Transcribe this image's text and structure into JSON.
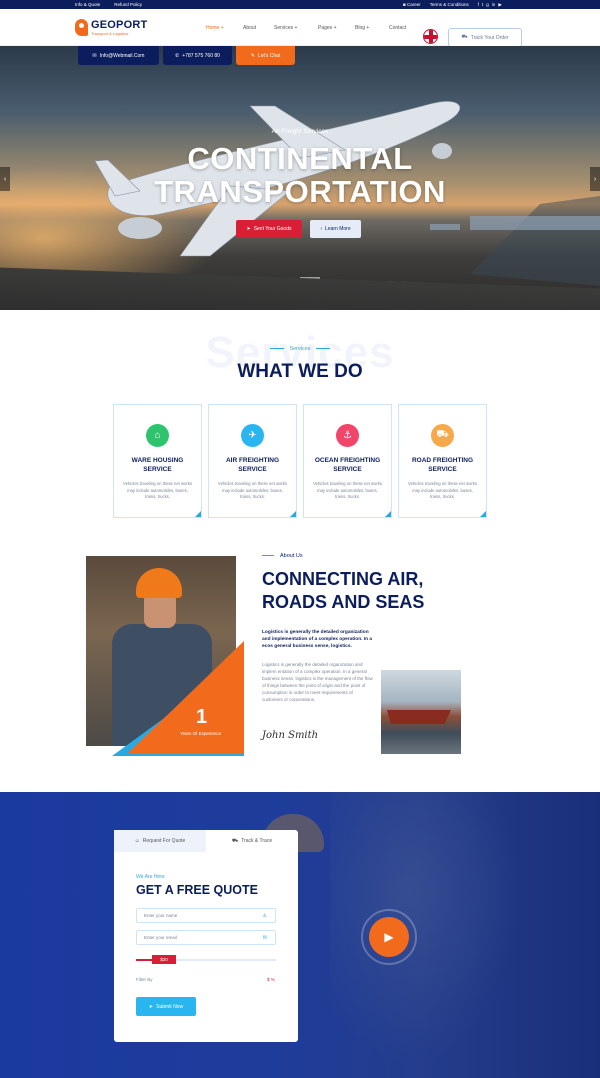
{
  "topbar": {
    "links": [
      "Info & Quote",
      "Refund Policy"
    ],
    "career": "Career",
    "terms": "Terms & Conditions",
    "social_icons": [
      "facebook-icon",
      "twitter-icon",
      "google-icon",
      "linkedin-icon",
      "youtube-icon"
    ]
  },
  "brand": {
    "name": "GEOPORT",
    "tagline": "Transport & Logistics"
  },
  "nav": {
    "items": [
      "Home +",
      "About",
      "Services +",
      "Pages +",
      "Blog +",
      "Contact"
    ],
    "active_index": 0
  },
  "header": {
    "track_order": "Track Your Order"
  },
  "contact_pills": {
    "email": "Info@Webmail.Com",
    "phone": "+787 575 760 80",
    "chat": "Let's Chat"
  },
  "hero": {
    "subtitle": "Air Freight Services",
    "title_line1": "CONTINENTAL",
    "title_line2": "TRANSPORTATION",
    "primary_button": "Sent Your Goods",
    "secondary_button": "Learn More"
  },
  "services": {
    "background_word": "Services",
    "kicker": "Services",
    "title": "WHAT WE DO",
    "cards": [
      {
        "title_line1": "WARE HOUSING",
        "title_line2": "SERVICE",
        "icon": "home-icon",
        "color": "#2ec46d",
        "description": "Vehicles traveling on these net works may include automobiles, buses, trains, trucks."
      },
      {
        "title_line1": "AIR FREIGHTING",
        "title_line2": "SERVICE",
        "icon": "plane-icon",
        "color": "#29b6f0",
        "description": "Vehicles traveling on these net works may include automobiles, buses, trains, trucks."
      },
      {
        "title_line1": "OCEAN FREIGHTING",
        "title_line2": "SERVICE",
        "icon": "ship-icon",
        "color": "#f2456a",
        "description": "Vehicles traveling on these net works may include automobiles, buses, trains, trucks."
      },
      {
        "title_line1": "ROAD FREIGHTING",
        "title_line2": "SERVICE",
        "icon": "truck-icon",
        "color": "#f7a94a",
        "description": "Vehicles traveling on these net works may include automobiles, buses, trains, trucks."
      }
    ]
  },
  "about": {
    "kicker": "About Us",
    "title_line1": "CONNECTING AIR,",
    "title_line2": "ROADS AND SEAS",
    "lead": "Logistics is generally the detailed organization and implementation of a complex operation. In a ecos general business sense, logistics.",
    "body": "Logistics is generally the detailed organization and implem entation of a complex operation. In a general business sense, logistics is the management of the flow of things between the point of origin and the point of consumption in order to meet requirements of customers or corporations.",
    "years_number": "1",
    "years_label": "Years Of Experience",
    "signature": "John Smith"
  },
  "quote": {
    "tabs": [
      "Request For Quote",
      "Track & Trace"
    ],
    "active_tab": 0,
    "kicker": "We Are Here",
    "title": "GET A FREE QUOTE",
    "name_placeholder": "Enter your name",
    "email_placeholder": "Enter your email",
    "slider_value": "$20",
    "slider_fraction": 0.28,
    "filter_label": "Filter By",
    "filter_value": "$ %",
    "submit": "Submit Now"
  },
  "colors": {
    "navy": "#0b1d5c",
    "orange": "#f26b1d",
    "red": "#d91f35",
    "sky": "#29a9e1"
  }
}
